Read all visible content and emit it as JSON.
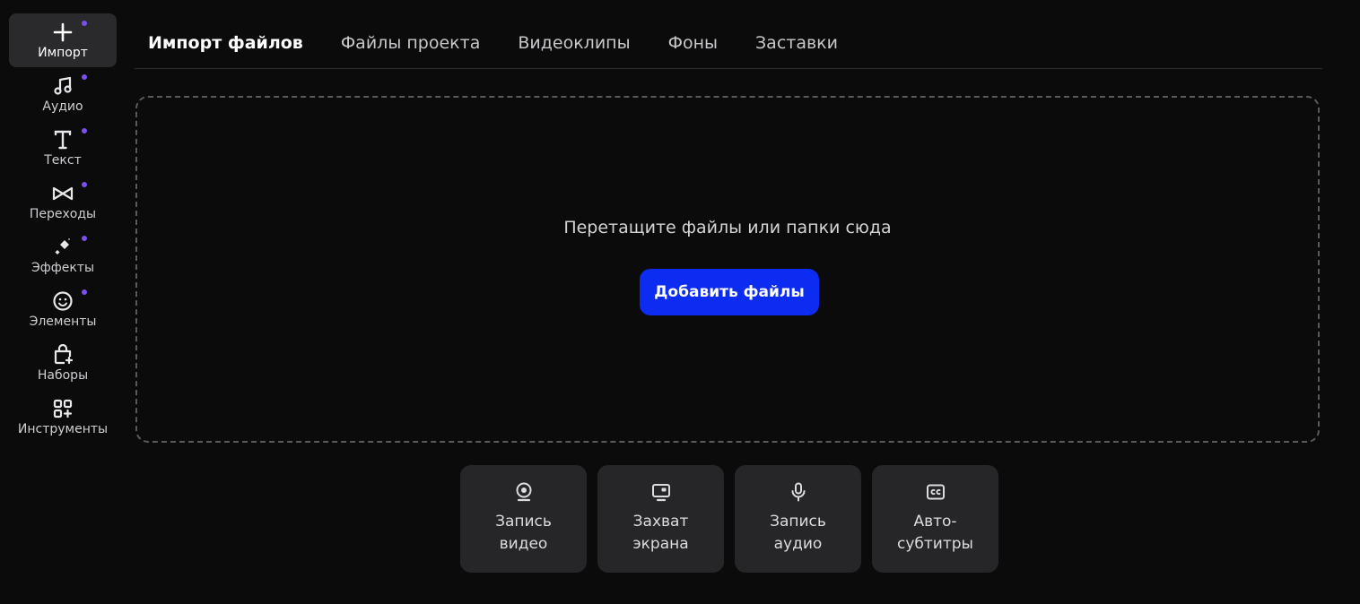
{
  "sidebar": {
    "items": [
      {
        "label": "Импорт",
        "icon": "plus-icon",
        "active": true
      },
      {
        "label": "Аудио",
        "icon": "music-note-icon"
      },
      {
        "label": "Текст",
        "icon": "text-icon"
      },
      {
        "label": "Переходы",
        "icon": "transitions-icon"
      },
      {
        "label": "Эффекты",
        "icon": "sparkle-icon"
      },
      {
        "label": "Элементы",
        "icon": "smiley-icon"
      },
      {
        "label": "Наборы",
        "icon": "bag-plus-icon"
      },
      {
        "label": "Инструменты",
        "icon": "grid-plus-icon"
      }
    ]
  },
  "tabs": [
    {
      "label": "Импорт файлов",
      "active": true
    },
    {
      "label": "Файлы проекта"
    },
    {
      "label": "Видеоклипы"
    },
    {
      "label": "Фоны"
    },
    {
      "label": "Заставки"
    }
  ],
  "dropzone": {
    "text": "Перетащите файлы или папки сюда",
    "button_label": "Добавить файлы"
  },
  "actions": [
    {
      "label": "Запись\nвидео",
      "icon": "webcam-icon"
    },
    {
      "label": "Захват\nэкрана",
      "icon": "screen-capture-icon"
    },
    {
      "label": "Запись\nаудио",
      "icon": "microphone-icon"
    },
    {
      "label": "Авто-\nсубтитры",
      "icon": "captions-icon"
    }
  ],
  "colors": {
    "background": "#0b0b0c",
    "accent": "#0c2cf2",
    "dot": "#7b4ff0",
    "card": "#262628"
  }
}
